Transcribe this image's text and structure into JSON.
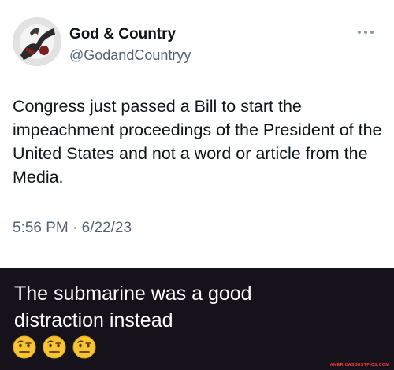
{
  "tweet": {
    "display_name": "God & Country",
    "handle": "@GodandCountryy",
    "text": "Congress just passed a Bill to start the impeachment proceedings of the President of the United States and not a word or article from the Media.",
    "timestamp": "5:56 PM · 6/22/23",
    "more_icon": "more-dots-icon"
  },
  "caption": {
    "text": "The submarine was a good distraction instead",
    "emojis": [
      "face-with-raised-eyebrow",
      "face-with-raised-eyebrow",
      "face-with-raised-eyebrow"
    ]
  },
  "watermark": "AMERICASBESTPICS.COM",
  "colors": {
    "caption_bg": "#15121b",
    "handle_gray": "#536471",
    "emoji_yellow": "#f7c531"
  }
}
